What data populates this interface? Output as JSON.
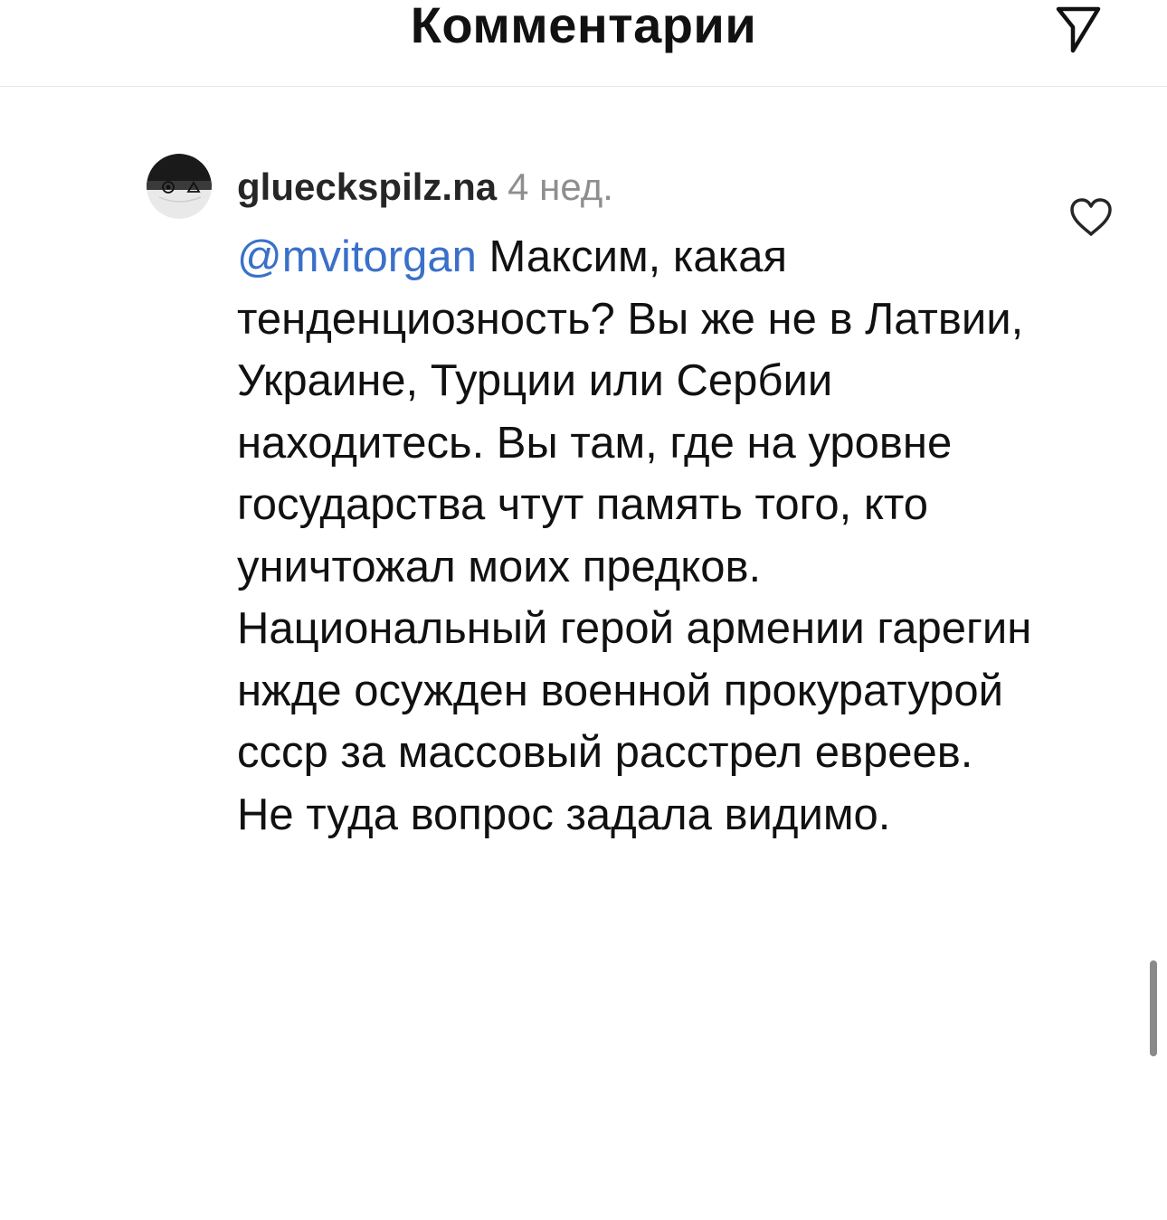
{
  "header": {
    "title": "Комментарии",
    "share_icon": "paper-plane-icon"
  },
  "comment": {
    "avatar_icon": "user-avatar-icon",
    "username": "glueckspilz.na",
    "time": "4 нед.",
    "mention": "@mvitorgan",
    "text": "Максим, какая тенденциозность? Вы же не в Латвии, Украине, Турции или Сербии находитесь. Вы там, где на уровне государства чтут память того, кто уничтожал моих предков. Национальный герой армении гарегин нжде осужден военной прокуратурой ссср за массовый расстрел евреев. Не туда вопрос задала видимо.",
    "like_icon": "heart-outline-icon"
  },
  "colors": {
    "mention": "#3a70c9",
    "timestamp": "#8e8e8e",
    "text": "#111111",
    "divider": "#e6e6e6"
  }
}
